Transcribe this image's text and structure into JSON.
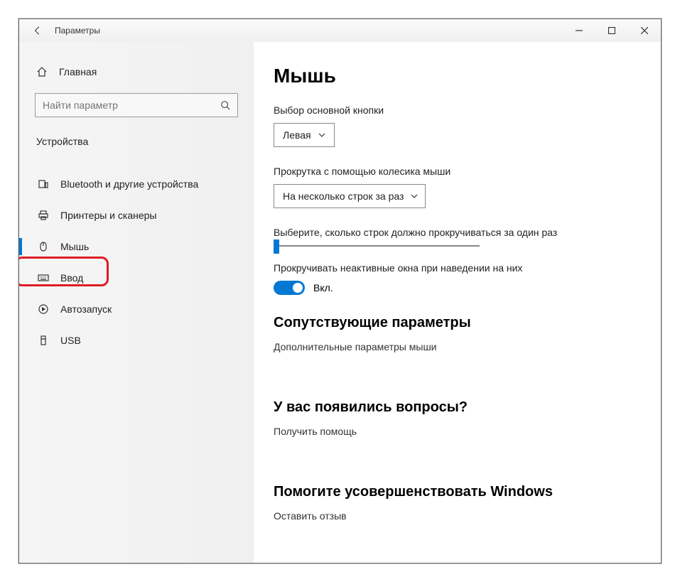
{
  "window": {
    "title": "Параметры"
  },
  "sidebar": {
    "home": "Главная",
    "search_placeholder": "Найти параметр",
    "section": "Устройства",
    "items": [
      {
        "label": "Bluetooth и другие устройства"
      },
      {
        "label": "Принтеры и сканеры"
      },
      {
        "label": "Мышь"
      },
      {
        "label": "Ввод"
      },
      {
        "label": "Автозапуск"
      },
      {
        "label": "USB"
      }
    ]
  },
  "main": {
    "heading": "Мышь",
    "primary_button_label": "Выбор основной кнопки",
    "primary_button_value": "Левая",
    "scroll_label": "Прокрутка с помощью колесика мыши",
    "scroll_value": "На несколько строк за раз",
    "lines_label": "Выберите, сколько строк должно прокручиваться за один раз",
    "inactive_label": "Прокручивать неактивные окна при наведении на них",
    "toggle_state": "Вкл.",
    "related_heading": "Сопутствующие параметры",
    "related_link": "Дополнительные параметры мыши",
    "questions_heading": "У вас появились вопросы?",
    "questions_link": "Получить помощь",
    "improve_heading": "Помогите усовершенствовать Windows",
    "improve_link": "Оставить отзыв"
  }
}
